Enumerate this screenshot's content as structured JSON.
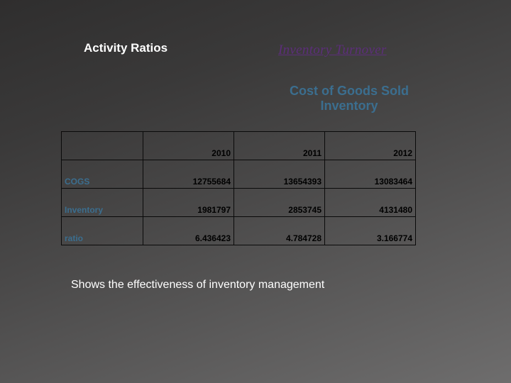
{
  "titles": {
    "left": "Activity Ratios",
    "right": "Inventory Turnover"
  },
  "formula": {
    "numerator": "Cost of Goods Sold",
    "denominator": "Inventory"
  },
  "chart_data": {
    "type": "table",
    "columns": [
      "2010",
      "2011",
      "2012"
    ],
    "rows": [
      {
        "label": "COGS",
        "values": [
          "12755684",
          "13654393",
          "13083464"
        ]
      },
      {
        "label": "Inventory",
        "values": [
          "1981797",
          "2853745",
          "4131480"
        ]
      },
      {
        "label": "ratio",
        "values": [
          "6.436423",
          "4.784728",
          "3.166774"
        ]
      }
    ]
  },
  "footer": "Shows the effectiveness of inventory management"
}
